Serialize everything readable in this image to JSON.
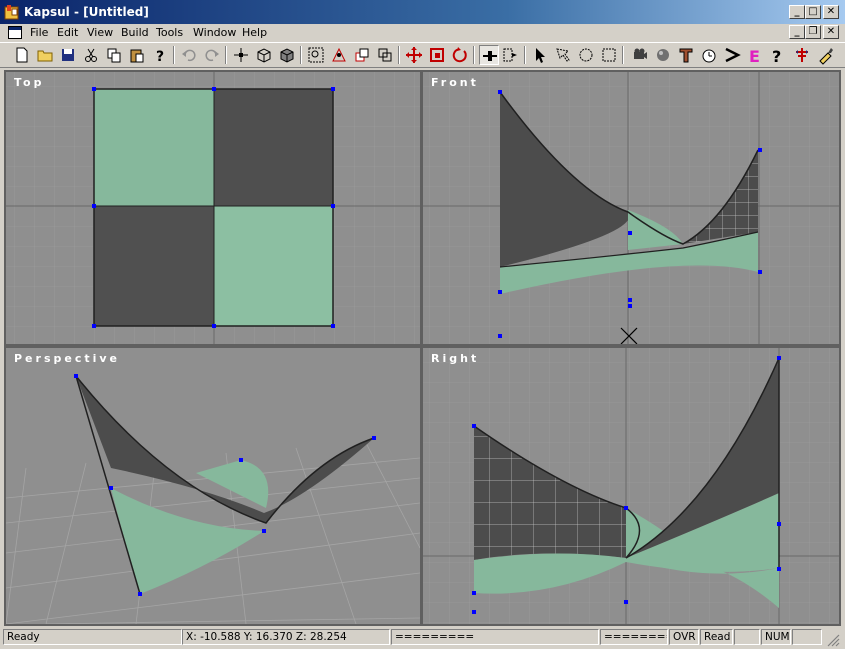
{
  "window": {
    "title": "Kapsul - [Untitled]"
  },
  "menu": {
    "items": [
      "File",
      "Edit",
      "View",
      "Build",
      "Tools",
      "Window",
      "Help"
    ]
  },
  "toolbar": {
    "buttons": [
      "new-file",
      "open-folder",
      "save",
      "cut",
      "copy",
      "paste",
      "help-cursor",
      "undo",
      "redo",
      "move-vertex",
      "wire-cube",
      "solid-cube",
      "zoom-window",
      "zoom-extents",
      "duplicate",
      "zoom-all",
      "move",
      "scale",
      "rotate",
      "snap",
      "select-options",
      "select-arrow",
      "select-region",
      "select-circle",
      "select-rect",
      "camera",
      "sphere",
      "object-tool",
      "clock",
      "arrow",
      "entity",
      "help",
      "tree",
      "paint"
    ]
  },
  "viewports": {
    "top": "Top",
    "front": "Front",
    "perspective": "Perspective",
    "right": "Right"
  },
  "status": {
    "ready": "Ready",
    "coords": "X: -10.588  Y:  16.370  Z:  28.254",
    "bar1": "=========",
    "bar2": "========",
    "ovr": "OVR",
    "read": "Read",
    "num": "NUM"
  },
  "colors": {
    "accent": "#0a246a",
    "viewport_bg": "#8f8f8f",
    "green_material": "#86b89c",
    "dark_material": "#4a4a4a",
    "control_point": "#0000ff"
  }
}
